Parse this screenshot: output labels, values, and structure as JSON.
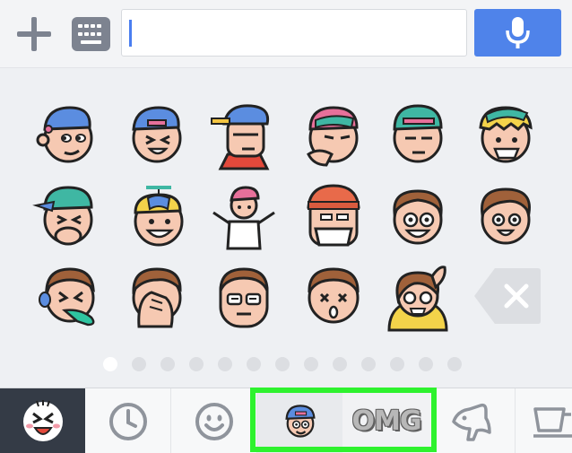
{
  "input_bar": {
    "message_value": "",
    "icons": {
      "add": "plus-icon",
      "keyboard": "keyboard-icon",
      "voice": "microphone-icon"
    },
    "accent_color": "#4f83ea"
  },
  "sticker_panel": {
    "stickers": [
      {
        "name": "boy-cap-smug"
      },
      {
        "name": "boy-cap-laughing"
      },
      {
        "name": "boy-backward-cap-cool"
      },
      {
        "name": "boy-pink-cap-thinking"
      },
      {
        "name": "boy-green-cap-bored"
      },
      {
        "name": "blond-boy-grin"
      },
      {
        "name": "boy-covering-mouth"
      },
      {
        "name": "boy-propeller-cap"
      },
      {
        "name": "boy-shrugging"
      },
      {
        "name": "boy-beanie-mask"
      },
      {
        "name": "nerd-smiling"
      },
      {
        "name": "boy-happy"
      },
      {
        "name": "boy-vomiting"
      },
      {
        "name": "boy-facepalm"
      },
      {
        "name": "nerd-glasses"
      },
      {
        "name": "boy-dizzy"
      },
      {
        "name": "girl-nervous"
      }
    ],
    "delete_icon": "backspace-icon",
    "page_count": 13,
    "active_page": 1
  },
  "tabs": [
    {
      "name": "line-sticker-pack",
      "icon": "sticker-face-icon",
      "selected": true
    },
    {
      "name": "recent",
      "icon": "clock-icon"
    },
    {
      "name": "emoji",
      "icon": "smiley-icon"
    },
    {
      "name": "boy-cap-pack",
      "icon": "boy-sticker-icon"
    },
    {
      "name": "omg-pack",
      "icon": "omg-text-icon",
      "label": "OMG"
    },
    {
      "name": "dog-pack",
      "icon": "dog-icon"
    },
    {
      "name": "cup-pack",
      "icon": "cup-icon"
    }
  ],
  "colors": {
    "highlight": "#2ef22e",
    "tab_selected": "#343b46"
  }
}
